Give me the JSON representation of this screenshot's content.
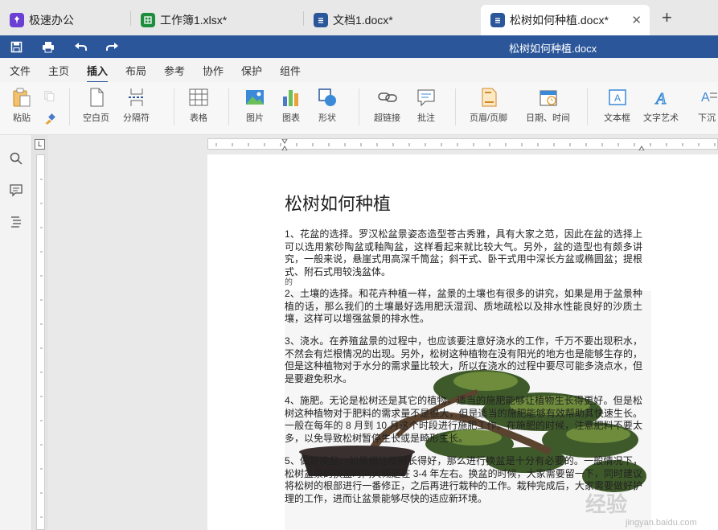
{
  "tabs": [
    {
      "label": "极速办公",
      "icon": "rocket-icon",
      "color": "#6b3fd4"
    },
    {
      "label": "工作簿1.xlsx*",
      "icon": "spreadsheet-icon",
      "color": "#1e8e3e"
    },
    {
      "label": "文档1.docx*",
      "icon": "document-icon",
      "color": "#2b579a"
    },
    {
      "label": "松树如何种植.docx*",
      "icon": "document-icon",
      "color": "#2b579a"
    }
  ],
  "titlebar": {
    "title": "松树如何种植.docx"
  },
  "menu": [
    "文件",
    "主页",
    "插入",
    "布局",
    "参考",
    "协作",
    "保护",
    "组件"
  ],
  "ribbon": {
    "paste": "粘贴",
    "blank_page": "空白页",
    "separator": "分隔符",
    "table": "表格",
    "picture": "图片",
    "chart": "图表",
    "shape": "形状",
    "hyperlink": "超链接",
    "comment": "批注",
    "header_footer": "页眉/页脚",
    "date_time": "日期、时间",
    "textbox": "文本框",
    "word_art": "文字艺术",
    "drop_cap": "下沉"
  },
  "document": {
    "title": "松树如何种植",
    "paragraphs": [
      "1、花盆的选择。罗汉松盆景姿态造型苍古秀雅，具有大家之范，因此在盆的选择上可以选用紫砂陶盆或釉陶盆，这样看起来就比较大气。另外，盆的造型也有颇多讲究，一般来说，悬崖式用高深千筒盆；斜干式、卧干式用中深长方盆或椭圆盆；提根式、附石式用较浅盆体。",
      "2、土壤的选择。和花卉种植一样，盆景的土壤也有很多的讲究，如果是用于盆景种植的话，那么我们的土壤最好选用肥沃湿润、质地疏松以及排水性能良好的沙质土壤，这样可以增强盆景的排水性。",
      "3、浇水。在养殖盆景的过程中，也应该要注意好浇水的工作，千万不要出现积水，不然会有烂根情况的出现。另外，松树这种植物在没有阳光的地方也是能够生存的，但是这种植物对于水分的需求量比较大，所以在浇水的过程中要尽可能多浇点水，但是要避免积水。",
      "4、施肥。无论是松树还是其它的植物，适当的施肥能够让植物生长得更好。但是松树这种植物对于肥料的需求量不是很大，但是适当的施肥能够有效帮助其快速生长。一般在每年的 8 月到 10 月这个时段进行施肥工作。在施肥的时候，注意肥料不要太多，以免导致松树暂停生长或是畸形生长。",
      "5、做好换盆。如果想让松树长得好，那么进行换盆是十分有必要的。一般情况下，松树盆景的换盆时间大概是在 3-4 年左右。换盆的时候，大家需要留一下，同时建议将松树的根部进行一番修正，之后再进行栽种的工作。栽种完成后，大家需要做好护理的工作，进而让盆景能够尽快的适应新环境。"
    ],
    "stray_char": "的",
    "watermark": "经验",
    "watermark_url": "jingyan.baidu.com"
  }
}
